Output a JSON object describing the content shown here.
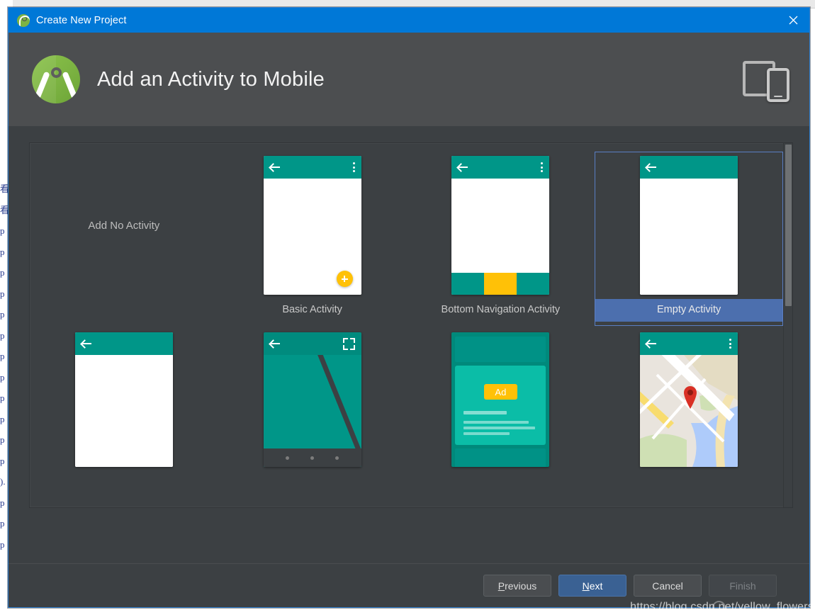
{
  "window": {
    "title": "Create New Project",
    "app_icon": "android-studio-icon",
    "close_icon": "close-icon"
  },
  "header": {
    "logo_icon": "android-studio-logo",
    "title": "Add an Activity to Mobile",
    "device_icon": "tablet-and-phone-icon"
  },
  "gallery": {
    "templates": [
      {
        "id": "add-no-activity",
        "label": "Add No Activity",
        "thumb": "none",
        "selected": false
      },
      {
        "id": "basic-activity",
        "label": "Basic Activity",
        "thumb": "basic",
        "selected": false
      },
      {
        "id": "bottom-navigation",
        "label": "Bottom Navigation Activity",
        "thumb": "bottomnav",
        "selected": false
      },
      {
        "id": "empty-activity",
        "label": "Empty Activity",
        "thumb": "empty",
        "selected": true
      },
      {
        "id": "fullscreen-like",
        "label": "",
        "thumb": "plain",
        "selected": false
      },
      {
        "id": "fullscreen-activity",
        "label": "",
        "thumb": "fullscreen",
        "selected": false
      },
      {
        "id": "google-admob-ads",
        "label": "",
        "thumb": "admob",
        "selected": false
      },
      {
        "id": "google-maps-activity",
        "label": "",
        "thumb": "maps",
        "selected": false
      }
    ],
    "admob_badge": "Ad",
    "scrollbar": "vertical-scrollbar"
  },
  "footer": {
    "previous": {
      "label": "Previous",
      "mnemonic": "P",
      "rest": "revious",
      "state": "enabled"
    },
    "next": {
      "label": "Next",
      "mnemonic": "N",
      "rest": "ext",
      "state": "default"
    },
    "cancel": {
      "label": "Cancel",
      "mnemonic": "",
      "rest": "Cancel",
      "state": "enabled"
    },
    "finish": {
      "label": "Finish",
      "mnemonic": "",
      "rest": "Finish",
      "state": "disabled"
    }
  },
  "watermark": "https://blog.csdn.net/yellow_flowers",
  "background": {
    "left_column_text": "看\n看\np\np\np\np\np\np\np\np\np\np\np\np\n).\np\np\np"
  },
  "colors": {
    "titlebar": "#0078d7",
    "header_bg": "#4c4e50",
    "content_bg": "#3c4043",
    "selection_blue": "#4c6fae",
    "accent_teal": "#009688",
    "accent_amber": "#ffc107",
    "primary_button": "#3a6193"
  }
}
